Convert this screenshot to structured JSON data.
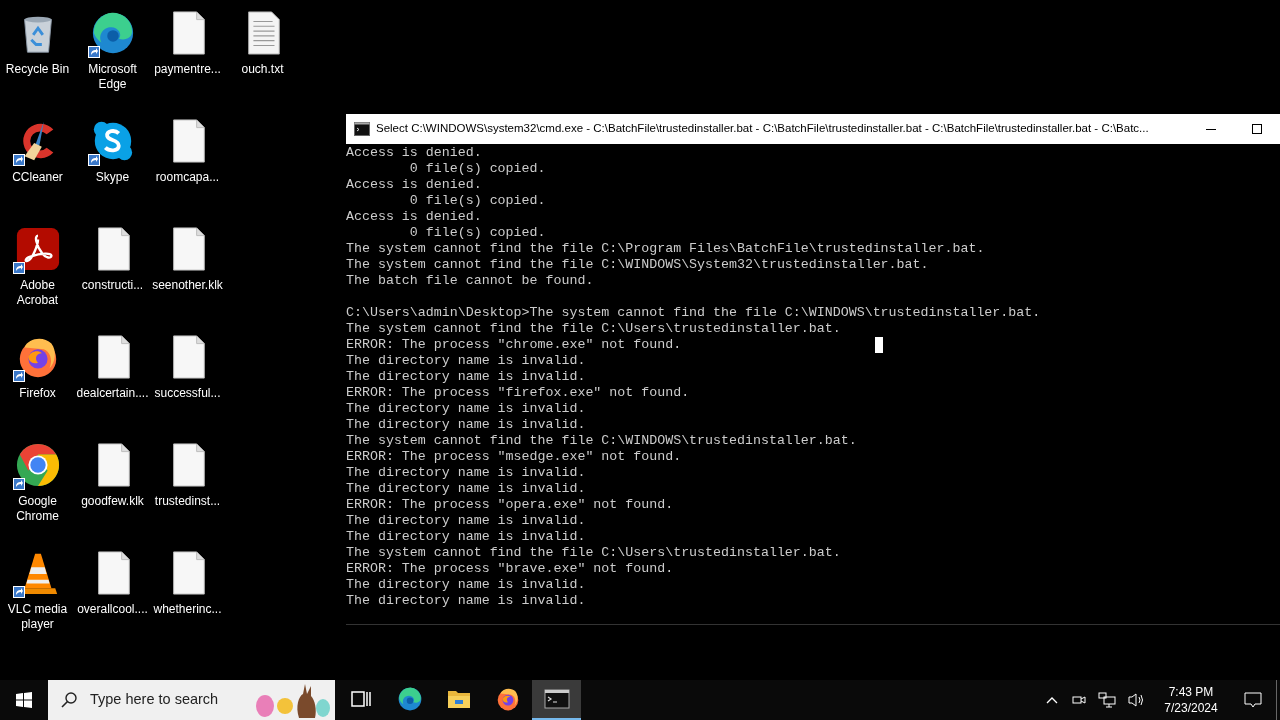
{
  "desktop": {
    "icon_rows": [
      [
        {
          "label": "Recycle Bin",
          "kind": "recycle",
          "shortcut": false
        },
        {
          "label": "Microsoft Edge",
          "kind": "edge",
          "shortcut": true
        },
        {
          "label": "paymentre...",
          "kind": "file",
          "shortcut": false
        },
        {
          "label": "ouch.txt",
          "kind": "text",
          "shortcut": false
        }
      ],
      [
        {
          "label": "CCleaner",
          "kind": "ccleaner",
          "shortcut": true
        },
        {
          "label": "Skype",
          "kind": "skype",
          "shortcut": true
        },
        {
          "label": "roomcapa...",
          "kind": "file",
          "shortcut": false
        }
      ],
      [
        {
          "label": "Adobe Acrobat",
          "kind": "acrobat",
          "shortcut": true
        },
        {
          "label": "constructi...",
          "kind": "file",
          "shortcut": false
        },
        {
          "label": "seenother.klk",
          "kind": "file",
          "shortcut": false
        }
      ],
      [
        {
          "label": "Firefox",
          "kind": "firefox",
          "shortcut": true
        },
        {
          "label": "dealcertain....",
          "kind": "file",
          "shortcut": false
        },
        {
          "label": "successful...",
          "kind": "file",
          "shortcut": false
        }
      ],
      [
        {
          "label": "Google Chrome",
          "kind": "chrome",
          "shortcut": true
        },
        {
          "label": "goodfew.klk",
          "kind": "file",
          "shortcut": false
        },
        {
          "label": "trustedinst...",
          "kind": "file",
          "shortcut": false
        }
      ],
      [
        {
          "label": "VLC media player",
          "kind": "vlc",
          "shortcut": true
        },
        {
          "label": "overallcool....",
          "kind": "file",
          "shortcut": false
        },
        {
          "label": "whetherinc...",
          "kind": "file",
          "shortcut": false
        }
      ]
    ]
  },
  "window": {
    "title": "Select C:\\WINDOWS\\system32\\cmd.exe - C:\\BatchFile\\trustedinstaller.bat - C:\\BatchFile\\trustedinstaller.bat - C:\\BatchFile\\trustedinstaller.bat - C:\\Batc...",
    "console_blocks": [
      [
        "Access is denied.",
        "        0 file(s) copied.",
        "Access is denied.",
        "        0 file(s) copied.",
        "Access is denied.",
        "        0 file(s) copied.",
        "The system cannot find the file C:\\Program Files\\BatchFile\\trustedinstaller.bat.",
        "The system cannot find the file C:\\WINDOWS\\System32\\trustedinstaller.bat.",
        "The batch file cannot be found."
      ],
      [
        "C:\\Users\\admin\\Desktop>The system cannot find the file C:\\WINDOWS\\trustedinstaller.bat.",
        "The system cannot find the file C:\\Users\\trustedinstaller.bat.",
        "ERROR: The process \"chrome.exe\" not found.",
        "The directory name is invalid.",
        "The directory name is invalid.",
        "ERROR: The process \"firefox.exe\" not found.",
        "The directory name is invalid.",
        "The directory name is invalid.",
        "The system cannot find the file C:\\WINDOWS\\trustedinstaller.bat.",
        "ERROR: The process \"msedge.exe\" not found.",
        "The directory name is invalid.",
        "The directory name is invalid.",
        "ERROR: The process \"opera.exe\" not found.",
        "The directory name is invalid.",
        "The directory name is invalid.",
        "The system cannot find the file C:\\Users\\trustedinstaller.bat.",
        "ERROR: The process \"brave.exe\" not found.",
        "The directory name is invalid.",
        "The directory name is invalid."
      ]
    ]
  },
  "taskbar": {
    "search": {
      "placeholder": "Type here to search"
    },
    "apps": [
      {
        "kind": "taskview",
        "selected": false
      },
      {
        "kind": "edge",
        "selected": false
      },
      {
        "kind": "explorer",
        "selected": false
      },
      {
        "kind": "firefox",
        "selected": false
      },
      {
        "kind": "cmd",
        "selected": true
      }
    ],
    "time": "7:43 PM",
    "date": "7/23/2024"
  }
}
